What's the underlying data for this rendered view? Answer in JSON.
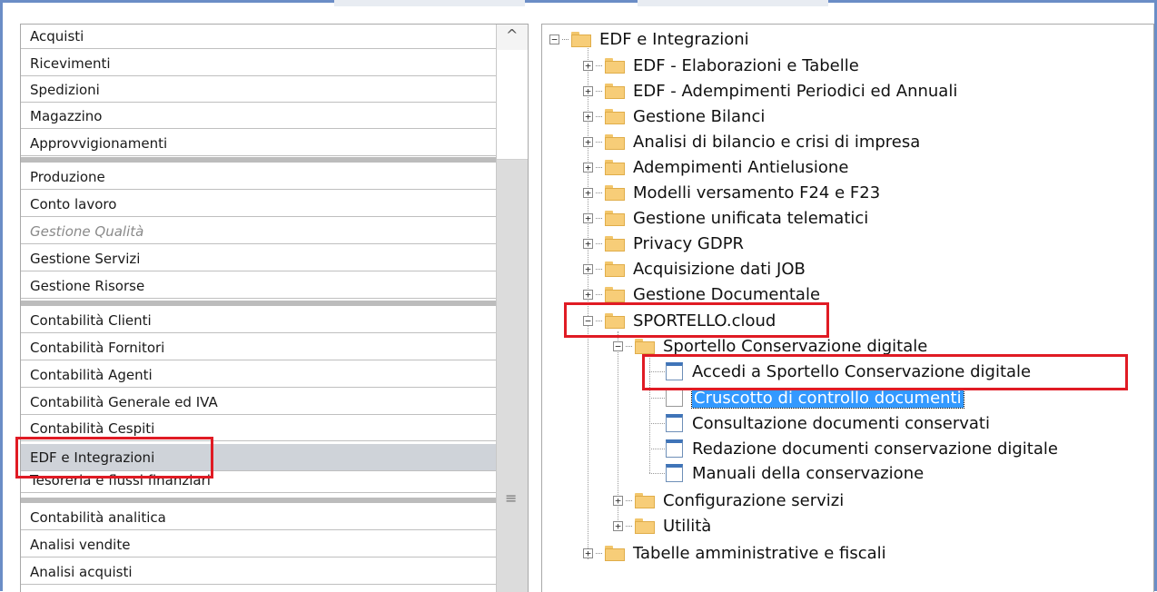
{
  "left_menu": {
    "items": [
      {
        "label": "Acquisti"
      },
      {
        "label": "Ricevimenti"
      },
      {
        "label": "Spedizioni"
      },
      {
        "label": "Magazzino"
      },
      {
        "label": "Approvvigionamenti"
      },
      {
        "label": "Produzione"
      },
      {
        "label": "Conto lavoro"
      },
      {
        "label": "Gestione Qualità"
      },
      {
        "label": "Gestione Servizi"
      },
      {
        "label": "Gestione Risorse"
      },
      {
        "label": "Contabilità Clienti"
      },
      {
        "label": "Contabilità Fornitori"
      },
      {
        "label": "Contabilità Agenti"
      },
      {
        "label": "Contabilità Generale ed IVA"
      },
      {
        "label": "Contabilità Cespiti"
      },
      {
        "label": "EDF e Integrazioni"
      },
      {
        "label": "Tesoreria e flussi finanziari"
      },
      {
        "label": "Contabilità analitica"
      },
      {
        "label": "Analisi vendite"
      },
      {
        "label": "Analisi acquisti"
      }
    ],
    "selected": "EDF e Integrazioni",
    "disabled": "Gestione Qualità",
    "scroll_up_glyph": "^",
    "scroll_grip_glyph": "≡"
  },
  "tree": {
    "root": {
      "label": "EDF e Integrazioni",
      "expander": "−"
    },
    "children": [
      {
        "label": "EDF - Elaborazioni e Tabelle",
        "expander": "+"
      },
      {
        "label": "EDF - Adempimenti Periodici ed Annuali",
        "expander": "+"
      },
      {
        "label": "Gestione Bilanci",
        "expander": "+"
      },
      {
        "label": "Analisi di bilancio e crisi di impresa",
        "expander": "+"
      },
      {
        "label": "Adempimenti Antielusione",
        "expander": "+"
      },
      {
        "label": "Modelli versamento F24 e F23",
        "expander": "+"
      },
      {
        "label": "Gestione unificata telematici",
        "expander": "+"
      },
      {
        "label": "Privacy GDPR",
        "expander": "+"
      },
      {
        "label": "Acquisizione dati JOB",
        "expander": "+"
      },
      {
        "label": "Gestione Documentale",
        "expander": "+"
      },
      {
        "label": "SPORTELLO.cloud",
        "expander": "−"
      }
    ],
    "sportello_children": [
      {
        "label": "Sportello Conservazione digitale",
        "expander": "−"
      },
      {
        "label": "Configurazione servizi",
        "expander": "+"
      },
      {
        "label": "Utilità",
        "expander": "+"
      }
    ],
    "conservazione_items": [
      {
        "label": "Accedi a Sportello Conservazione digitale"
      },
      {
        "label": "Cruscotto di controllo documenti"
      },
      {
        "label": "Consultazione documenti conservati"
      },
      {
        "label": "Redazione documenti conservazione digitale"
      },
      {
        "label": "Manuali della conservazione"
      }
    ],
    "last_root_child": {
      "label": "Tabelle amministrative e fiscali",
      "expander": "+"
    },
    "selected_item": "Cruscotto di controllo documenti"
  },
  "colors": {
    "highlight_red": "#e01b24",
    "selection_blue": "#3399ff",
    "folder_yellow": "#f7cd78",
    "frame_blue": "#6b8dc6"
  }
}
